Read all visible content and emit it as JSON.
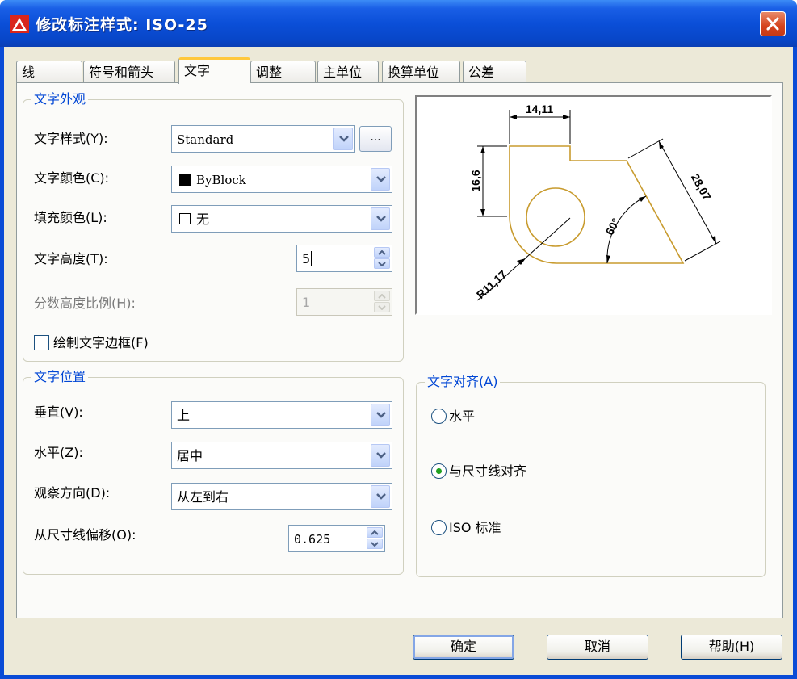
{
  "window": {
    "title": "修改标注样式: ISO-25"
  },
  "tabs": [
    {
      "label": "线"
    },
    {
      "label": "符号和箭头"
    },
    {
      "label": "文字"
    },
    {
      "label": "调整"
    },
    {
      "label": "主单位"
    },
    {
      "label": "换算单位"
    },
    {
      "label": "公差"
    }
  ],
  "appearance": {
    "legend": "文字外观",
    "style_label": "文字样式(Y):",
    "style_value": "Standard",
    "browse_label": "...",
    "color_label": "文字颜色(C):",
    "color_value": "ByBlock",
    "fill_label": "填充颜色(L):",
    "fill_value": "无",
    "height_label": "文字高度(T):",
    "height_value": "5",
    "fraction_label": "分数高度比例(H):",
    "fraction_value": "1",
    "frame_label": "绘制文字边框(F)",
    "frame_checked": false
  },
  "placement": {
    "legend": "文字位置",
    "vertical_label": "垂直(V):",
    "vertical_value": "上",
    "horizontal_label": "水平(Z):",
    "horizontal_value": "居中",
    "view_label": "观察方向(D):",
    "view_value": "从左到右",
    "offset_label": "从尺寸线偏移(O):",
    "offset_value": "0.625"
  },
  "alignment": {
    "legend": "文字对齐(A)",
    "options": [
      {
        "label": "水平",
        "selected": false
      },
      {
        "label": "与尺寸线对齐",
        "selected": true
      },
      {
        "label": "ISO 标准",
        "selected": false
      }
    ]
  },
  "preview": {
    "dim_top": "14,11",
    "dim_left": "16,6",
    "dim_right": "28,07",
    "dim_angle": "60°",
    "dim_radius": "R11,17"
  },
  "buttons": {
    "ok": "确定",
    "cancel": "取消",
    "help": "帮助(H)"
  },
  "colors": {
    "accent": "#0046d5",
    "title_bar": "#0b4fd8",
    "dialog_bg": "#ece9d8",
    "preview_geometry": "#c89b2e"
  }
}
